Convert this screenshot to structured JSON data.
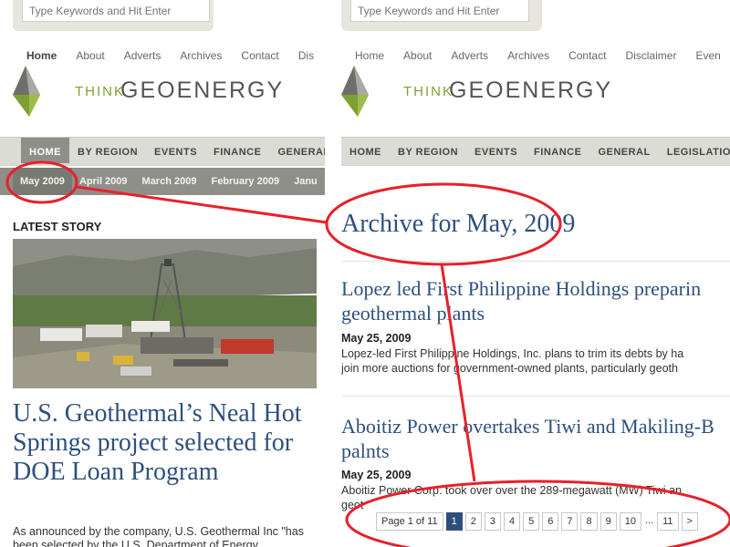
{
  "search": {
    "placeholder": "Type Keywords and Hit Enter"
  },
  "left": {
    "top_nav": [
      "Home",
      "About",
      "Adverts",
      "Archives",
      "Contact",
      "Dis"
    ],
    "logo": {
      "think": "THINK",
      "geo": "GEOENERGY"
    },
    "main_nav": [
      "HOME",
      "BY REGION",
      "EVENTS",
      "FINANCE",
      "GENERAL"
    ],
    "sub_nav": [
      "May 2009",
      "April 2009",
      "March 2009",
      "February 2009",
      "Janu"
    ],
    "latest_label": "LATEST STORY",
    "story_title": "U.S. Geothermal’s Neal Hot Springs project selected for DOE Loan Program",
    "story_excerpt": "As announced by the company, U.S. Geothermal Inc \"has been selected by the U.S. Department of Energy"
  },
  "right": {
    "top_nav": [
      "Home",
      "About",
      "Adverts",
      "Archives",
      "Contact",
      "Disclaimer",
      "Even"
    ],
    "logo": {
      "think": "THINK",
      "geo": "GEOENERGY"
    },
    "main_nav": [
      "HOME",
      "BY REGION",
      "EVENTS",
      "FINANCE",
      "GENERAL",
      "LEGISLATION"
    ],
    "archive_title": "Archive for May, 2009",
    "posts": [
      {
        "title_line1": "Lopez led First Philippine Holdings preparin",
        "title_line2": "geothermal plants",
        "date": "May 25, 2009",
        "excerpt_line1": "Lopez-led First Philippine Holdings, Inc. plans to trim its debts by ha",
        "excerpt_line2": "join more auctions for government-owned plants, particularly geoth"
      },
      {
        "title_line1": "Aboitiz Power overtakes Tiwi and Makiling-B",
        "title_line2": "palnts",
        "date": "May 25, 2009",
        "excerpt_line1": "Aboitiz Power Corp. took over over the 289-megawatt (MW) Tiwi an",
        "excerpt_line2": "geot"
      }
    ],
    "pagination": {
      "page_info": "Page 1 of 11",
      "pages": [
        "1",
        "2",
        "3",
        "4",
        "5",
        "6",
        "7",
        "8",
        "9",
        "10"
      ],
      "dots": "...",
      "last": "11",
      "next": ">"
    }
  },
  "colors": {
    "link_blue": "#2e4f7d",
    "annotation_red": "#e8202b",
    "nav_gray": "#8f8f8a",
    "logo_green": "#7ea033"
  }
}
